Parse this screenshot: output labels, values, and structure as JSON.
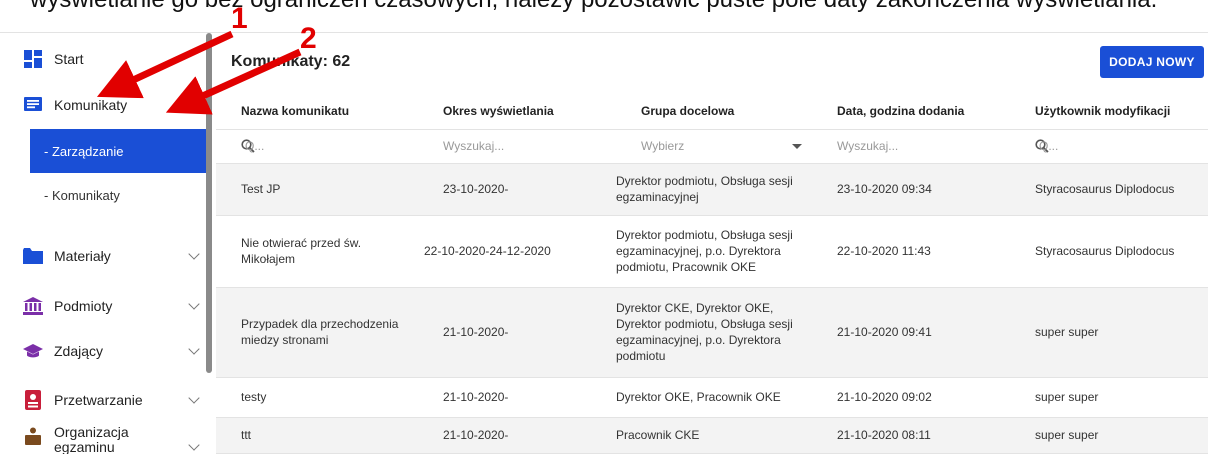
{
  "caption": "wyświetlanie go bez ograniczeń czasowych, należy pozostawić puste pole daty zakończenia wyświetlania.",
  "annotations": [
    "1",
    "2"
  ],
  "sidebar": {
    "items": [
      {
        "label": "Start",
        "icon": "dashboard-icon"
      },
      {
        "label": "Komunikaty",
        "icon": "message-icon"
      },
      {
        "label": "- Zarządzanie",
        "active": true
      },
      {
        "label": "- Komunikaty"
      },
      {
        "label": "Materiały",
        "icon": "folder-icon"
      },
      {
        "label": "Podmioty",
        "icon": "institution-icon"
      },
      {
        "label": "Zdający",
        "icon": "graduation-cap-icon"
      },
      {
        "label": "Przetwarzanie",
        "icon": "id-card-icon"
      },
      {
        "label": "Organizacja egzaminu",
        "icon": "organization-icon"
      }
    ],
    "accent_color": "#1a4fd6"
  },
  "main": {
    "title": "Komunikaty: 62",
    "add_button": "DODAJ NOWY",
    "columns": [
      "Nazwa komunikatu",
      "Okres wyświetlania",
      "Grupa docelowa",
      "Data, godzina dodania",
      "Użytkownik modyfikacji"
    ],
    "filters": {
      "name": "Q...",
      "period": "Wyszukaj...",
      "group": "Wybierz",
      "date": "Wyszukaj...",
      "user": "Q..."
    },
    "rows": [
      [
        "Test JP",
        "23-10-2020-",
        "Dyrektor podmiotu, Obsługa sesji egzaminacyjnej",
        "23-10-2020 09:34",
        "Styracosaurus Diplodocus"
      ],
      [
        "Nie otwierać przed św. Mikołajem",
        "22-10-2020-24-12-2020",
        "Dyrektor podmiotu, Obsługa sesji egzaminacyjnej, p.o. Dyrektora podmiotu, Pracownik OKE",
        "22-10-2020 11:43",
        "Styracosaurus Diplodocus"
      ],
      [
        "Przypadek dla przechodzenia miedzy stronami",
        "21-10-2020-",
        "Dyrektor CKE, Dyrektor OKE, Dyrektor podmiotu, Obsługa sesji egzaminacyjnej, p.o. Dyrektora podmiotu",
        "21-10-2020 09:41",
        "super super"
      ],
      [
        "testy",
        "21-10-2020-",
        "Dyrektor OKE, Pracownik OKE",
        "21-10-2020 09:02",
        "super super"
      ],
      [
        "ttt",
        "21-10-2020-",
        "Pracownik CKE",
        "21-10-2020 08:11",
        "super super"
      ]
    ]
  }
}
